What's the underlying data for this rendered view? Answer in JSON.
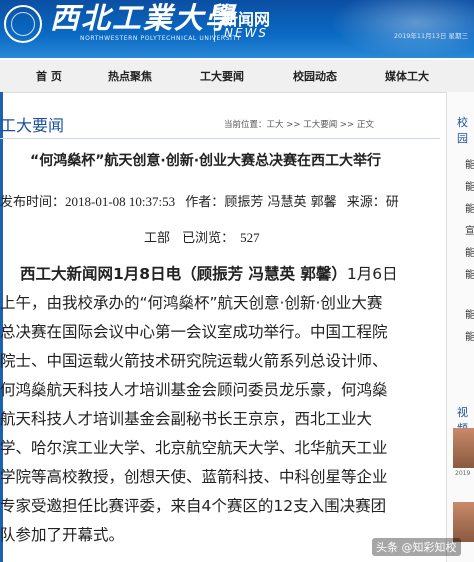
{
  "header": {
    "site_name": "西北工業大學",
    "site_name_en": "NORTHWESTERN POLYTECHNICAL UNIVERSITY",
    "news_cn": "新闻网",
    "news_en": "NEWS",
    "date": "2019年11月13日 星期三"
  },
  "nav": {
    "items": [
      {
        "label": "首 页"
      },
      {
        "label": "热点聚焦"
      },
      {
        "label": "工大要闻"
      },
      {
        "label": "校园动态"
      },
      {
        "label": "媒体工大"
      }
    ]
  },
  "section": {
    "title": "工大要闻",
    "breadcrumb": {
      "label": "当前位置：",
      "home": "工大",
      "sep1": " >> ",
      "section": "工大要闻",
      "sep2": " >> ",
      "current": "正文"
    }
  },
  "sidebar": {
    "heading": "校园",
    "items": [
      "能",
      "能",
      "能",
      "宣",
      "能",
      "能",
      "能",
      "能"
    ],
    "video_heading": "视频",
    "video_date": "2019"
  },
  "article": {
    "title": "“何鸿燊杯”航天创意·创新·创业大赛总决赛在西工大举行",
    "meta": {
      "publish_label": "发布时间：",
      "publish_time": "2018-01-08 10:37:53",
      "author_label": "作者：",
      "authors": "顾振芳 冯慧英 郭馨",
      "source_label": "来源：",
      "source_part1": "研",
      "source_part2": "工部",
      "views_label": "已浏览：",
      "views": "527"
    },
    "lines": [
      {
        "lead": "西工大新闻网1月8日电（顾振芳 冯慧英 郭馨）",
        "text": "1月6日"
      },
      {
        "lead": "",
        "text": "上午，由我校承办的“何鸿燊杯”航天创意·创新·创业大赛"
      },
      {
        "lead": "",
        "text": "总决赛在国际会议中心第一会议室成功举行。中国工程院"
      },
      {
        "lead": "",
        "text": "院士、中国运载火箭技术研究院运载火箭系列总设计师、"
      },
      {
        "lead": "",
        "text": "何鸿燊航天科技人才培训基金会顾问委员龙乐豪，何鸿燊"
      },
      {
        "lead": "",
        "text": "航天科技人才培训基金会副秘书长王京京，西北工业大"
      },
      {
        "lead": "",
        "text": "学、哈尔滨工业大学、北京航空航天大学、北华航天工业"
      },
      {
        "lead": "",
        "text": "学院等高校教授，创想天使、蓝箭科技、中科创星等企业"
      },
      {
        "lead": "",
        "text": "专家受邀担任比赛评委，来自4个赛区的12支入围决赛团"
      },
      {
        "lead": "",
        "text": "队参加了开幕式。"
      }
    ]
  },
  "watermark": "头条 @知彩知校"
}
